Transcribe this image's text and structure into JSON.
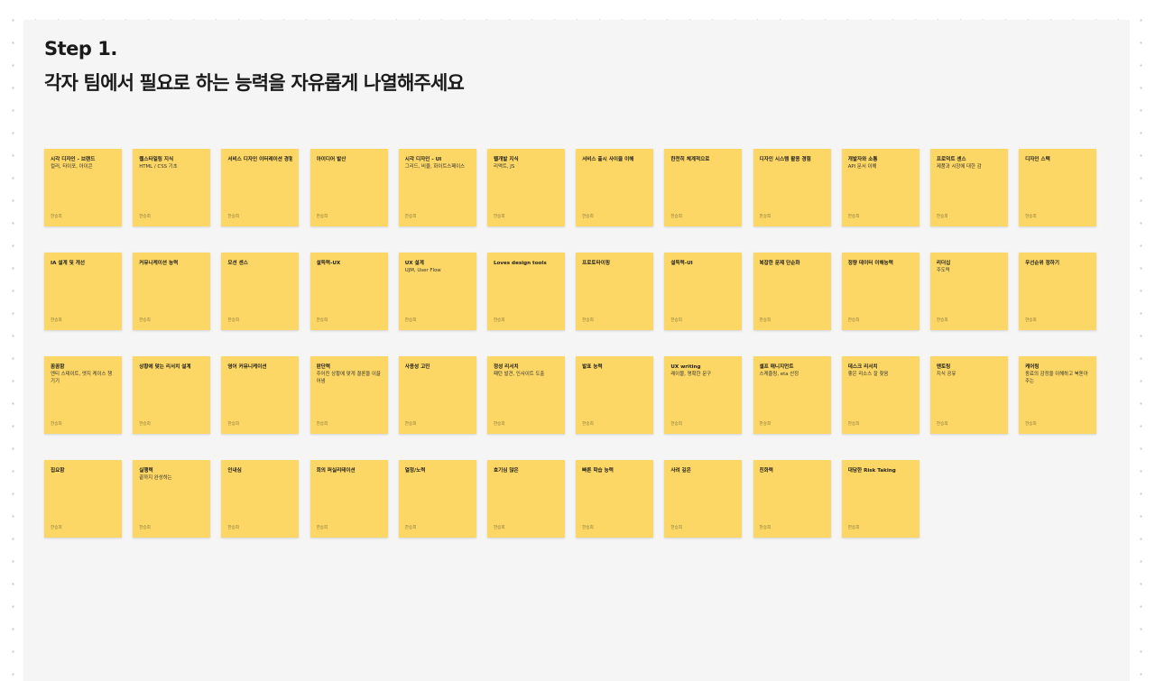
{
  "header": {
    "title": "Step 1.",
    "subtitle": "각자 팀에서 필요로 하는 능력을 자유롭게 나열해주세요"
  },
  "colors": {
    "background": "#ffffff",
    "frame": "#f5f5f5",
    "sticky": "#fcd765"
  },
  "stickies": [
    {
      "title": "시각 디자인 - 브랜드",
      "desc": "컬러, 타이포, 아이콘",
      "author": "한승희"
    },
    {
      "title": "웹스타일링 지식",
      "desc": "HTML / CSS 기초",
      "author": "한승희"
    },
    {
      "title": "서비스 디자인 이터레이션 경험",
      "desc": "",
      "author": "한승희"
    },
    {
      "title": "아이디어 발산",
      "desc": "",
      "author": "한승희"
    },
    {
      "title": "시각 디자인 - UI",
      "desc": "그리드, 비율, 화이트스페이스",
      "author": "한승희"
    },
    {
      "title": "웹개발 지식",
      "desc": "리액트, JS",
      "author": "한승희"
    },
    {
      "title": "서비스 출시 사이클 이해",
      "desc": "",
      "author": "한승희"
    },
    {
      "title": "한천히 체계적으로",
      "desc": "",
      "author": "한승희"
    },
    {
      "title": "디자인 시스템 활용 경험",
      "desc": "",
      "author": "한승희"
    },
    {
      "title": "개발자와 소통",
      "desc": "API 문서 이해",
      "author": "한승희"
    },
    {
      "title": "프로덕트 센스",
      "desc": "제품과 시장에 대한 감",
      "author": "한승희"
    },
    {
      "title": "디자인 스텍",
      "desc": "",
      "author": "한승희"
    },
    {
      "title": "IA 설계 및 개선",
      "desc": "",
      "author": "한승희"
    },
    {
      "title": "커뮤니케이션 능력",
      "desc": "",
      "author": "한승희"
    },
    {
      "title": "모션 센스",
      "desc": "",
      "author": "한승희"
    },
    {
      "title": "설득력-UX",
      "desc": "",
      "author": "한승희"
    },
    {
      "title": "UX 설계",
      "desc": "UJM, User Flow",
      "author": "한승희"
    },
    {
      "title": "Loves design tools",
      "desc": "",
      "author": "한승희"
    },
    {
      "title": "프로토타이핑",
      "desc": "",
      "author": "한승희"
    },
    {
      "title": "설득력-UI",
      "desc": "",
      "author": "한승희"
    },
    {
      "title": "복잡한 문제 단순화",
      "desc": "",
      "author": "한승희"
    },
    {
      "title": "정량 데이터 이해능력",
      "desc": "",
      "author": "한승희"
    },
    {
      "title": "리더십",
      "desc": "주도력",
      "author": "한승희"
    },
    {
      "title": "우선순위 정하기",
      "desc": "",
      "author": "한승희"
    },
    {
      "title": "꼼꼼함",
      "desc": "엔티 스테이트, 엣지 케이스 챙기기",
      "author": "한승희"
    },
    {
      "title": "상황에 맞는 리서치 설계",
      "desc": "",
      "author": "한승희"
    },
    {
      "title": "영어 커뮤니케이션",
      "desc": "",
      "author": "한승희"
    },
    {
      "title": "판단력",
      "desc": "주어진 상황에 맞게 결론을 이끌어냄",
      "author": "한승희"
    },
    {
      "title": "사용성 고민",
      "desc": "",
      "author": "한승희"
    },
    {
      "title": "정성 리서치",
      "desc": "패턴 발견, 인사이트 도출",
      "author": "한승희"
    },
    {
      "title": "발표 능력",
      "desc": "",
      "author": "한승희"
    },
    {
      "title": "UX writing",
      "desc": "레이블, 명확한 문구",
      "author": "한승희"
    },
    {
      "title": "셀프 매니지먼트",
      "desc": "스케줄링, eta 산정",
      "author": "한승희"
    },
    {
      "title": "데스크 리서치",
      "desc": "좋은 리소스 잘 찾음",
      "author": "한승희"
    },
    {
      "title": "멘토링",
      "desc": "지식 공유",
      "author": "한승희"
    },
    {
      "title": "케어링",
      "desc": "동료의 감정을 이해하고 북돋아주는",
      "author": "한승희"
    },
    {
      "title": "집요함",
      "desc": "",
      "author": "한승희"
    },
    {
      "title": "실행력",
      "desc": "끝까지 완성하는",
      "author": "한승희"
    },
    {
      "title": "인내심",
      "desc": "",
      "author": "한승희"
    },
    {
      "title": "회의 퍼실리테이션",
      "desc": "",
      "author": "한승희"
    },
    {
      "title": "열정/노력",
      "desc": "",
      "author": "한승희"
    },
    {
      "title": "호기심 많은",
      "desc": "",
      "author": "한승희"
    },
    {
      "title": "빠른 학습 능력",
      "desc": "",
      "author": "한승희"
    },
    {
      "title": "사려 깊은",
      "desc": "",
      "author": "한승희"
    },
    {
      "title": "친화력",
      "desc": "",
      "author": "한승희"
    },
    {
      "title": "대담한 Risk Taking",
      "desc": "",
      "author": "한승희"
    }
  ]
}
